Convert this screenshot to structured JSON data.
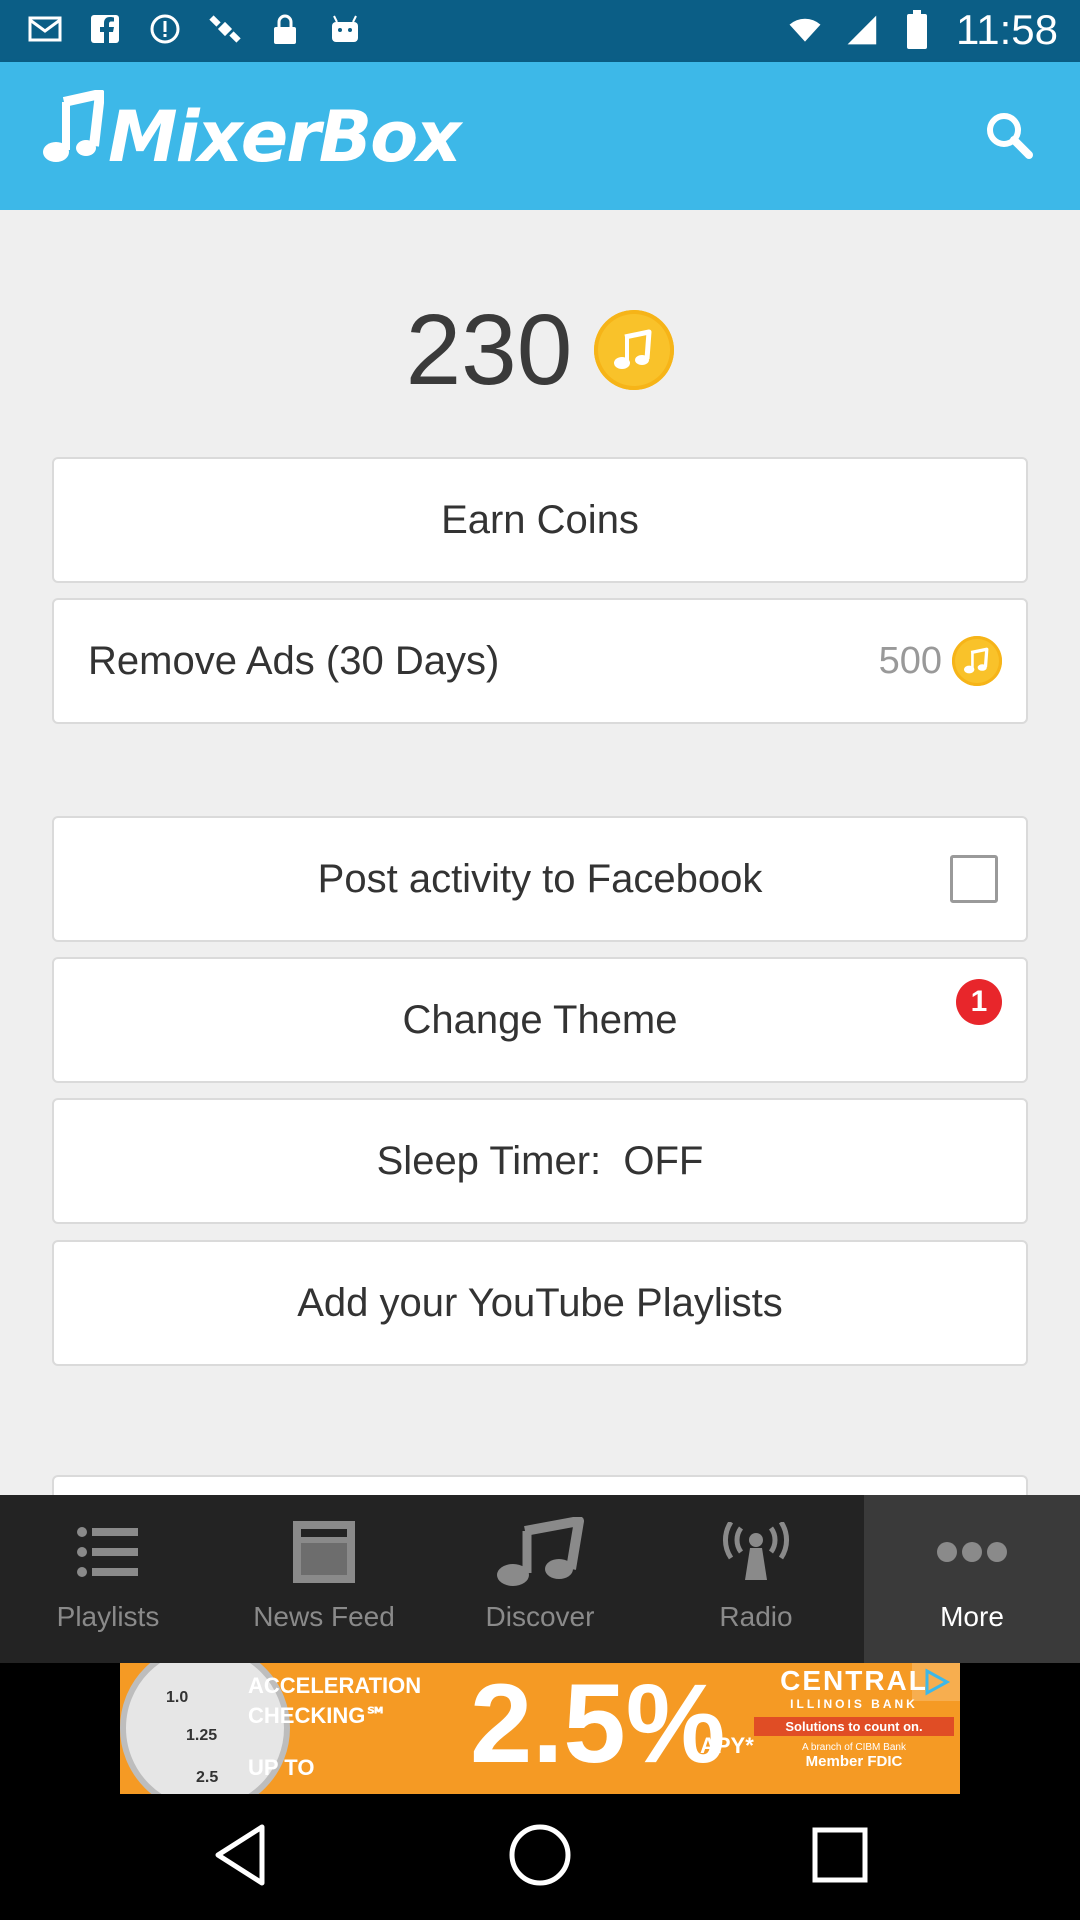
{
  "status_bar": {
    "time": "11:58",
    "icons": [
      "mail-icon",
      "facebook-icon",
      "alert-icon",
      "satellite-icon",
      "lock-icon",
      "android-icon",
      "wifi-icon",
      "signal-icon",
      "battery-icon"
    ]
  },
  "app_bar": {
    "logo_text": "MixerBox",
    "search_icon": "search-icon",
    "color": "#3db8e8"
  },
  "coins": {
    "balance": "230",
    "coin_color": "#f9c22a"
  },
  "cards": {
    "earn_coins": "Earn Coins",
    "remove_ads": "Remove Ads (30 Days)",
    "remove_ads_price": "500",
    "post_facebook": "Post activity to Facebook",
    "post_facebook_checked": false,
    "change_theme": "Change Theme",
    "change_theme_badge": "1",
    "sleep_timer": "Sleep Timer:  OFF",
    "youtube_playlists": "Add your YouTube Playlists"
  },
  "bottom_nav": {
    "items": [
      {
        "label": "Playlists",
        "icon": "list-icon"
      },
      {
        "label": "News Feed",
        "icon": "newsfeed-icon"
      },
      {
        "label": "Discover",
        "icon": "music-note-icon"
      },
      {
        "label": "Radio",
        "icon": "radio-icon"
      },
      {
        "label": "More",
        "icon": "more-icon"
      }
    ],
    "active": "More"
  },
  "ad": {
    "line1": "ACCELERATION",
    "line2": "CHECKING℠",
    "upto": "UP TO",
    "rate": "2.5%",
    "apy": "APY*",
    "bank_name": "CENTRAL",
    "bank_sub": "ILLINOIS BANK",
    "tagline": "Solutions to count on.",
    "branch": "A branch of CIBM Bank",
    "fdic": "Member FDIC",
    "gauge_labels": [
      "1.0",
      "1.25",
      "2.5"
    ]
  },
  "system_nav": {
    "icons": [
      "back-icon",
      "home-icon",
      "recents-icon"
    ]
  }
}
